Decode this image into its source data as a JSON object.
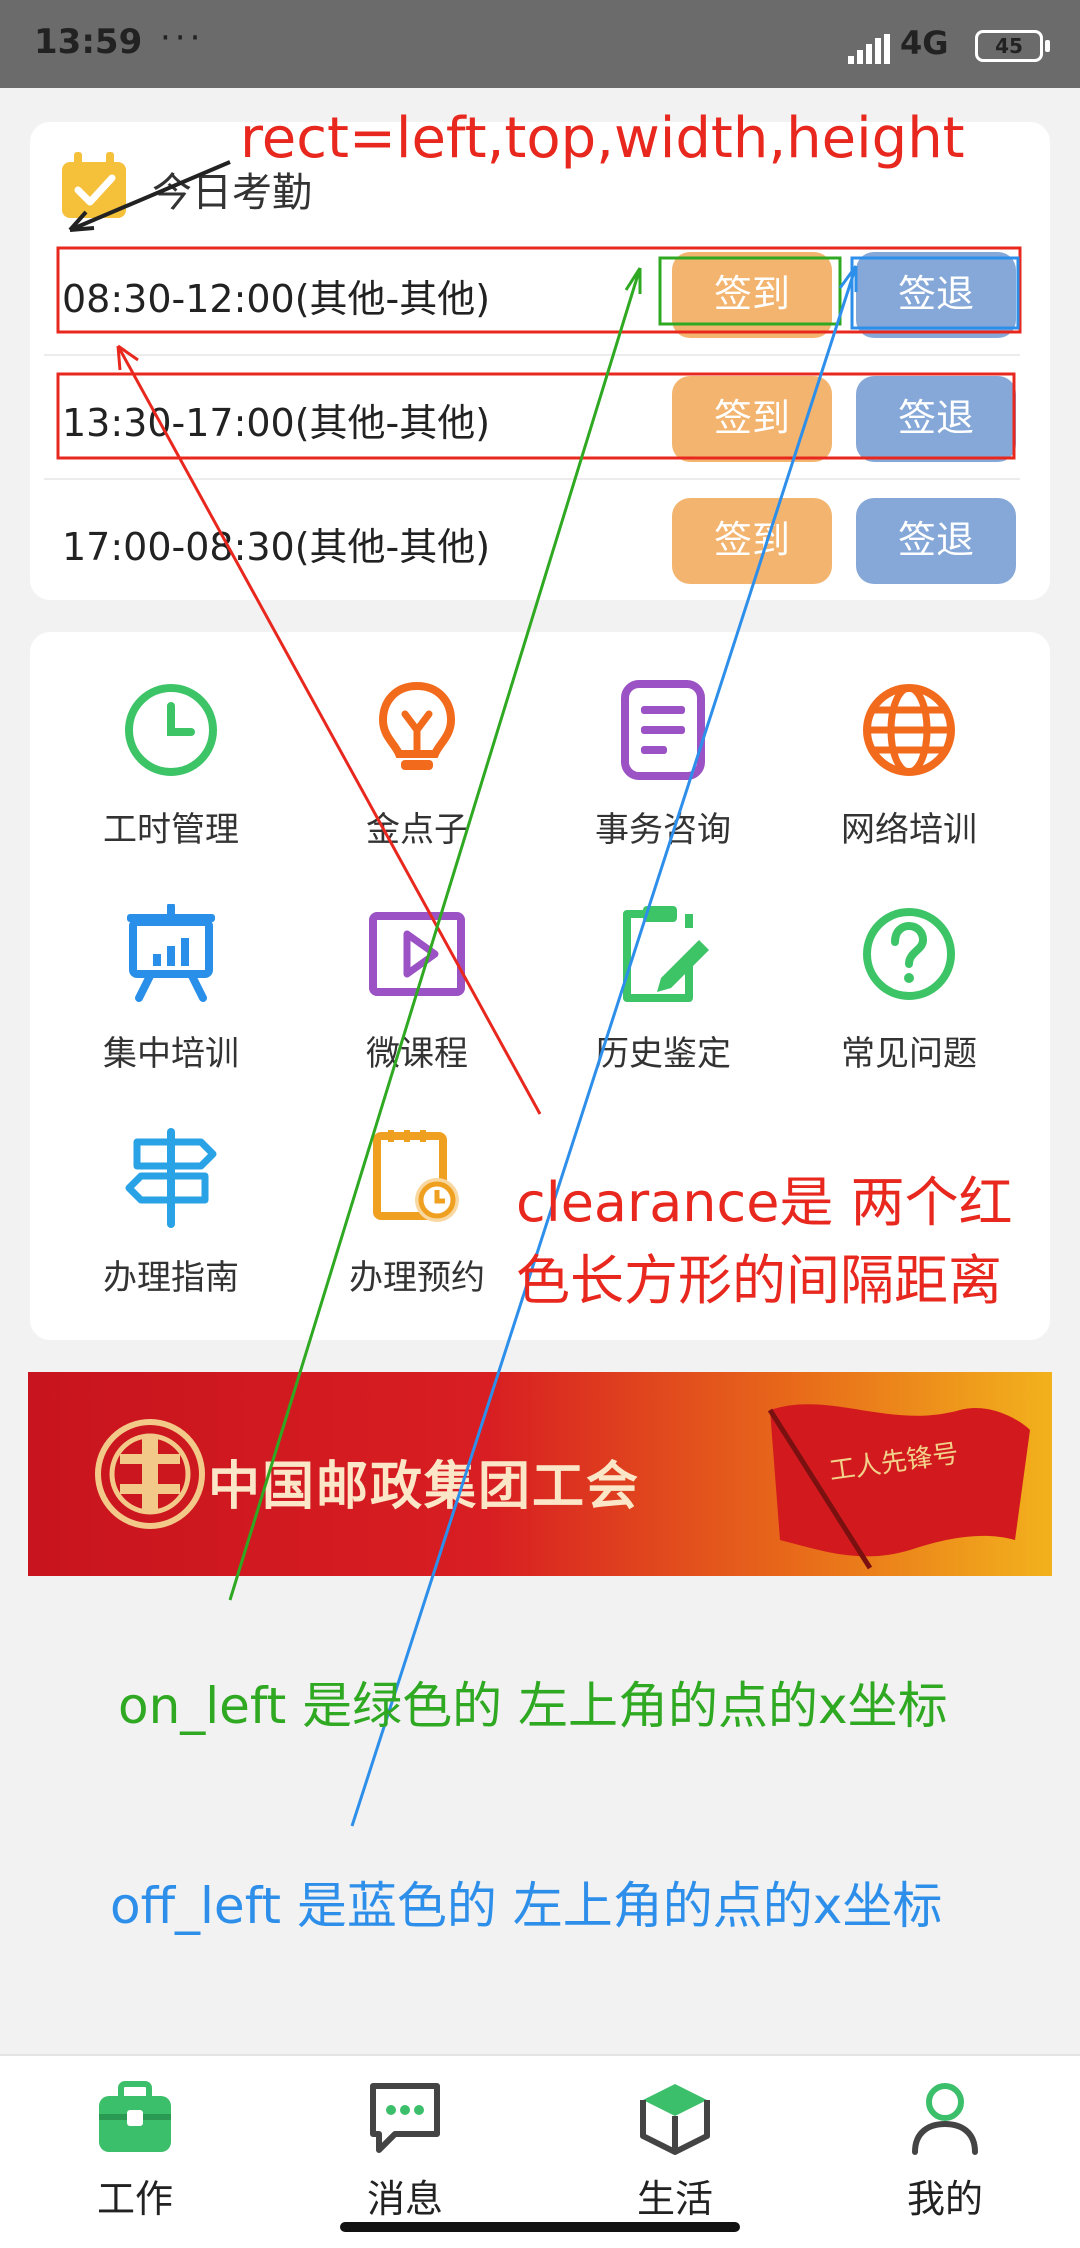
{
  "status_bar": {
    "time": "13:59",
    "dots": "···",
    "network": "4G",
    "battery": "45"
  },
  "attendance": {
    "title": "今日考勤",
    "rows": [
      {
        "time": "08:30-12:00(其他-其他)",
        "checkin": "签到",
        "checkout": "签退"
      },
      {
        "time": "13:30-17:00(其他-其他)",
        "checkin": "签到",
        "checkout": "签退"
      },
      {
        "time": "17:00-08:30(其他-其他)",
        "checkin": "签到",
        "checkout": "签退"
      }
    ]
  },
  "grid": {
    "items": [
      {
        "label": "工时管理",
        "icon": "clock-icon"
      },
      {
        "label": "金点子",
        "icon": "lightbulb-icon"
      },
      {
        "label": "事务咨询",
        "icon": "document-icon"
      },
      {
        "label": "网络培训",
        "icon": "globe-icon"
      },
      {
        "label": "集中培训",
        "icon": "presentation-board-icon"
      },
      {
        "label": "微课程",
        "icon": "video-play-icon"
      },
      {
        "label": "历史鉴定",
        "icon": "clipboard-edit-icon"
      },
      {
        "label": "常见问题",
        "icon": "question-icon"
      },
      {
        "label": "办理指南",
        "icon": "signpost-icon"
      },
      {
        "label": "办理预约",
        "icon": "calendar-clock-icon"
      }
    ]
  },
  "banner": {
    "text": "中国邮政集团工会",
    "flag_text": "工人先锋号"
  },
  "annotations": {
    "rect": "rect=left,top,width,height",
    "clearance_line1": "clearance是 两个红",
    "clearance_line2": "色长方形的间隔距离",
    "on_left": "on_left 是绿色的 左上角的点的x坐标",
    "off_left": "off_left 是蓝色的 左上角的点的x坐标"
  },
  "bottom_nav": {
    "items": [
      {
        "label": "工作",
        "icon": "briefcase-icon",
        "active": true
      },
      {
        "label": "消息",
        "icon": "message-icon",
        "active": false
      },
      {
        "label": "生活",
        "icon": "cube-icon",
        "active": false
      },
      {
        "label": "我的",
        "icon": "person-icon",
        "active": false
      }
    ]
  },
  "colors": {
    "checkin": "#f3b46f",
    "checkout": "#86a8d8",
    "annotation_red": "#e8281e",
    "annotation_green": "#2fa822",
    "annotation_blue": "#2d8fea",
    "active_green": "#3cbf6a"
  }
}
